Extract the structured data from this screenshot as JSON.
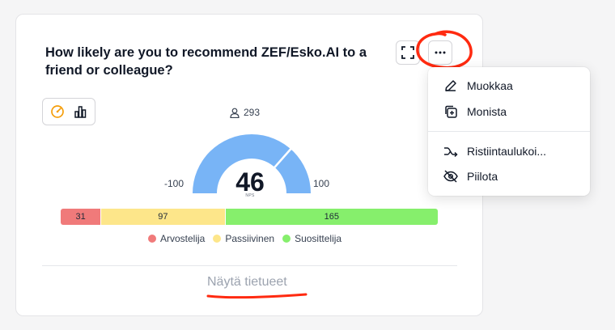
{
  "question": "How likely are you to recommend ZEF/Esko.AI to a friend or colleague?",
  "respondents": "293",
  "nps": {
    "value": "46",
    "unit_label": "NPS",
    "min_label": "-100",
    "max_label": "100"
  },
  "distribution": {
    "detractors": "31",
    "passives": "97",
    "promoters": "165"
  },
  "legend": {
    "detractors": "Arvostelija",
    "passives": "Passiivinen",
    "promoters": "Suosittelija"
  },
  "colors": {
    "detractors": "#f07a7a",
    "passives": "#fde68a",
    "promoters": "#86ef6c",
    "gauge": "#78b4f6",
    "accent": "#f59e0b",
    "annotation": "#ff2a10"
  },
  "icons": {
    "fullscreen": "fullscreen-icon",
    "more": "more-horizontal-icon",
    "gauge_view": "gauge-icon",
    "bar_view": "bar-chart-icon",
    "user": "user-icon"
  },
  "show_data_link": "Näytä tietueet",
  "menu": {
    "items": [
      {
        "label": "Muokkaa",
        "icon": "edit-icon"
      },
      {
        "label": "Monista",
        "icon": "duplicate-icon"
      },
      {
        "label": "Ristiintaulukoi...",
        "icon": "crosstab-icon"
      },
      {
        "label": "Piilota",
        "icon": "eye-off-icon"
      }
    ]
  }
}
